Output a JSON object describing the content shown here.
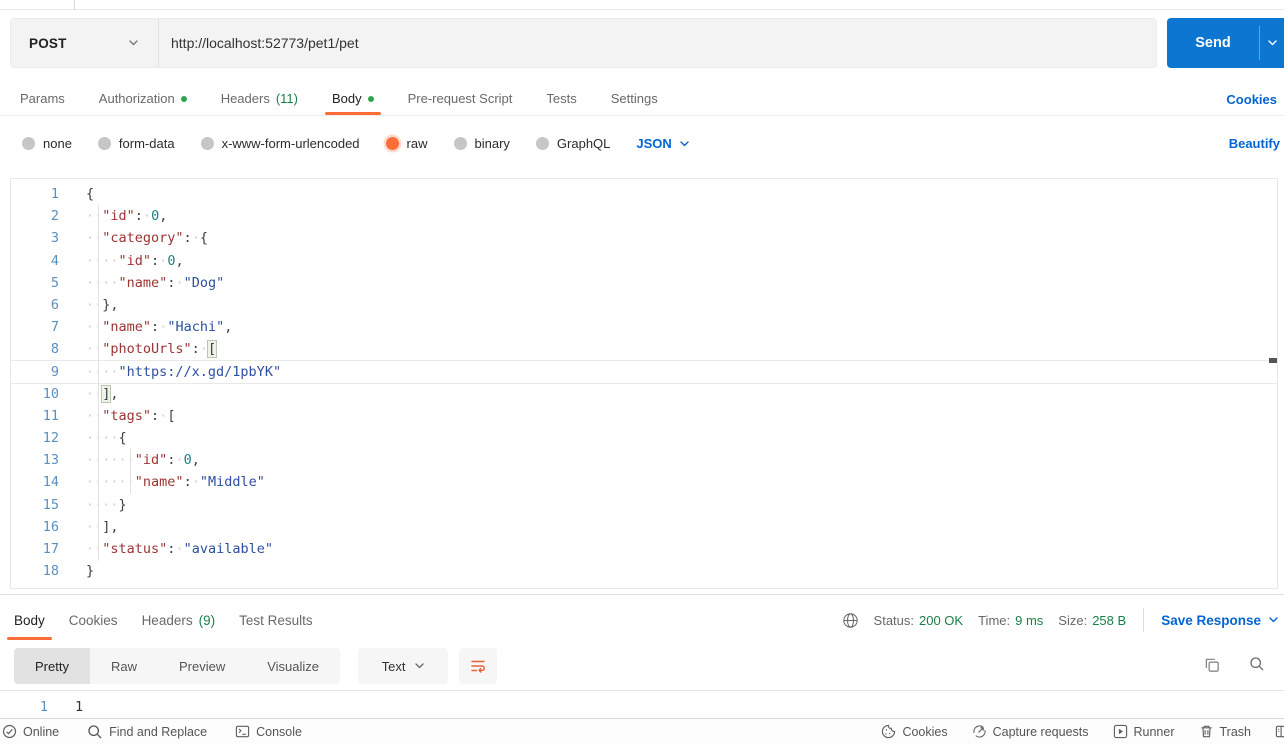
{
  "colors": {
    "accent": "#ff6c37",
    "send_blue": "#0d76d1",
    "link_blue": "#0265d2",
    "green_text": "#1a7f45",
    "green_dot": "#2ea44f",
    "code_key": "#9c3434",
    "code_str": "#2e4fa0",
    "code_num": "#1a8282",
    "line_num": "#5a8fc0"
  },
  "topbar": {
    "method": "POST",
    "url": "http://localhost:52773/pet1/pet",
    "send": "Send"
  },
  "request_tabs": [
    {
      "label": "Params"
    },
    {
      "label": "Authorization",
      "dot": true
    },
    {
      "label": "Headers",
      "count": "(11)"
    },
    {
      "label": "Body",
      "dot": true,
      "active": true
    },
    {
      "label": "Pre-request Script"
    },
    {
      "label": "Tests"
    },
    {
      "label": "Settings"
    }
  ],
  "cookies_link": "Cookies",
  "body_modes": [
    {
      "label": "none"
    },
    {
      "label": "form-data"
    },
    {
      "label": "x-www-form-urlencoded"
    },
    {
      "label": "raw",
      "selected": true
    },
    {
      "label": "binary"
    },
    {
      "label": "GraphQL"
    }
  ],
  "language_selector": "JSON",
  "beautify_link": "Beautify",
  "editor": {
    "lines": [
      {
        "n": "1",
        "seg": [
          [
            "punc",
            "{"
          ]
        ]
      },
      {
        "n": "2",
        "seg": [
          [
            "ws",
            "··"
          ],
          [
            "key",
            "\"id\""
          ],
          [
            "punc",
            ":"
          ],
          [
            "ws",
            "·"
          ],
          [
            "num",
            "0"
          ],
          [
            "punc",
            ","
          ]
        ]
      },
      {
        "n": "3",
        "seg": [
          [
            "ws",
            "··"
          ],
          [
            "key",
            "\"category\""
          ],
          [
            "punc",
            ":"
          ],
          [
            "ws",
            "·"
          ],
          [
            "punc",
            "{"
          ]
        ]
      },
      {
        "n": "4",
        "seg": [
          [
            "ws",
            "····"
          ],
          [
            "key",
            "\"id\""
          ],
          [
            "punc",
            ":"
          ],
          [
            "ws",
            "·"
          ],
          [
            "num",
            "0"
          ],
          [
            "punc",
            ","
          ]
        ]
      },
      {
        "n": "5",
        "seg": [
          [
            "ws",
            "····"
          ],
          [
            "key",
            "\"name\""
          ],
          [
            "punc",
            ":"
          ],
          [
            "ws",
            "·"
          ],
          [
            "str",
            "\"Dog\""
          ]
        ]
      },
      {
        "n": "6",
        "seg": [
          [
            "ws",
            "··"
          ],
          [
            "punc",
            "},"
          ]
        ]
      },
      {
        "n": "7",
        "seg": [
          [
            "ws",
            "··"
          ],
          [
            "key",
            "\"name\""
          ],
          [
            "punc",
            ":"
          ],
          [
            "ws",
            "·"
          ],
          [
            "str",
            "\"Hachi\""
          ],
          [
            "punc",
            ","
          ]
        ]
      },
      {
        "n": "8",
        "seg": [
          [
            "ws",
            "··"
          ],
          [
            "key",
            "\"photoUrls\""
          ],
          [
            "punc",
            ":"
          ],
          [
            "ws",
            "·"
          ],
          [
            "match",
            "["
          ]
        ]
      },
      {
        "n": "9",
        "active": true,
        "seg": [
          [
            "ws",
            "····"
          ],
          [
            "str",
            "\"https://x.gd/1pbYK\""
          ]
        ]
      },
      {
        "n": "10",
        "seg": [
          [
            "ws",
            "··"
          ],
          [
            "match",
            "]"
          ],
          [
            "punc",
            ","
          ]
        ]
      },
      {
        "n": "11",
        "seg": [
          [
            "ws",
            "··"
          ],
          [
            "key",
            "\"tags\""
          ],
          [
            "punc",
            ":"
          ],
          [
            "ws",
            "·"
          ],
          [
            "punc",
            "["
          ]
        ]
      },
      {
        "n": "12",
        "seg": [
          [
            "ws",
            "····"
          ],
          [
            "punc",
            "{"
          ]
        ]
      },
      {
        "n": "13",
        "seg": [
          [
            "ws",
            "······"
          ],
          [
            "key",
            "\"id\""
          ],
          [
            "punc",
            ":"
          ],
          [
            "ws",
            "·"
          ],
          [
            "num",
            "0"
          ],
          [
            "punc",
            ","
          ]
        ]
      },
      {
        "n": "14",
        "seg": [
          [
            "ws",
            "······"
          ],
          [
            "key",
            "\"name\""
          ],
          [
            "punc",
            ":"
          ],
          [
            "ws",
            "·"
          ],
          [
            "str",
            "\"Middle\""
          ]
        ]
      },
      {
        "n": "15",
        "seg": [
          [
            "ws",
            "····"
          ],
          [
            "punc",
            "}"
          ]
        ]
      },
      {
        "n": "16",
        "seg": [
          [
            "ws",
            "··"
          ],
          [
            "punc",
            "],"
          ]
        ]
      },
      {
        "n": "17",
        "seg": [
          [
            "ws",
            "··"
          ],
          [
            "key",
            "\"status\""
          ],
          [
            "punc",
            ":"
          ],
          [
            "ws",
            "·"
          ],
          [
            "str",
            "\"available\""
          ]
        ]
      },
      {
        "n": "18",
        "seg": [
          [
            "punc",
            "}"
          ]
        ]
      }
    ]
  },
  "response": {
    "tabs": [
      {
        "label": "Body",
        "active": true
      },
      {
        "label": "Cookies"
      },
      {
        "label": "Headers",
        "count": "(9)"
      },
      {
        "label": "Test Results"
      }
    ],
    "meta": [
      {
        "label": "Status:",
        "value": "200 OK"
      },
      {
        "label": "Time:",
        "value": "9 ms"
      },
      {
        "label": "Size:",
        "value": "258 B"
      }
    ],
    "save_response": "Save Response",
    "view_tabs": [
      {
        "label": "Pretty",
        "selected": true
      },
      {
        "label": "Raw"
      },
      {
        "label": "Preview"
      },
      {
        "label": "Visualize"
      }
    ],
    "format_selector": "Text",
    "body_lines": [
      {
        "n": "1",
        "text": "1"
      }
    ]
  },
  "status_bar": {
    "left": [
      {
        "icon": "online-icon",
        "label": "Online"
      },
      {
        "icon": "search-icon",
        "label": "Find and Replace"
      },
      {
        "icon": "console-icon",
        "label": "Console"
      }
    ],
    "right": [
      {
        "icon": "cookie-icon",
        "label": "Cookies"
      },
      {
        "icon": "capture-icon",
        "label": "Capture requests"
      },
      {
        "icon": "runner-icon",
        "label": "Runner"
      },
      {
        "icon": "trash-icon",
        "label": "Trash"
      }
    ]
  }
}
